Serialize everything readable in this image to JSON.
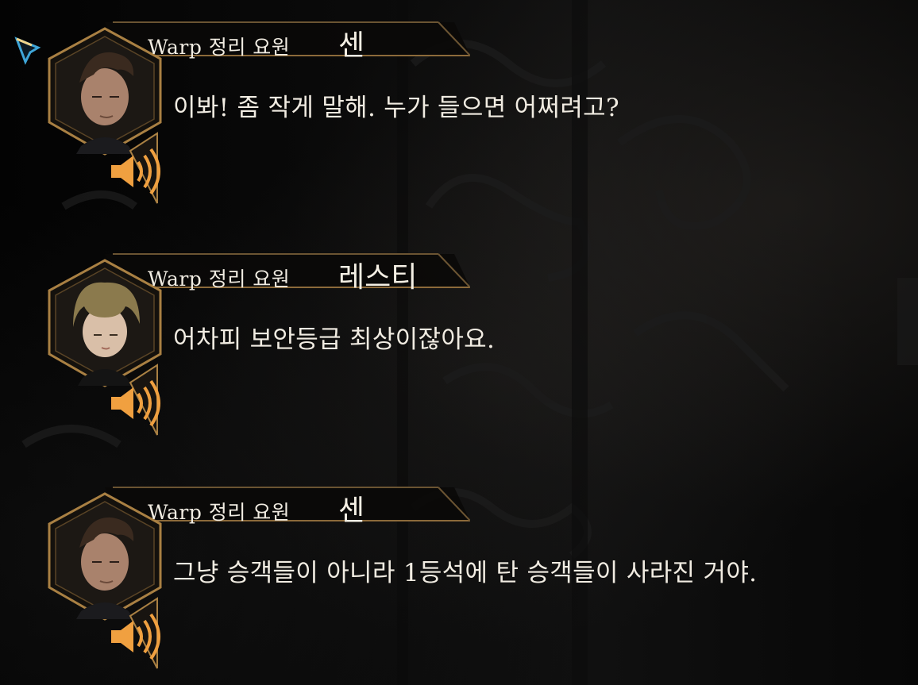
{
  "dialogue_log": [
    {
      "speaker_title": "Warp 정리 요원",
      "speaker_name": "센",
      "portrait": "sen-portrait",
      "text": "이봐! 좀 작게 말해. 누가 들으면 어쩌려고?",
      "voice_icon": "speaker-icon"
    },
    {
      "speaker_title": "Warp 정리 요원",
      "speaker_name": "레스티",
      "portrait": "resti-portrait",
      "text": "어차피 보안등급 최상이잖아요.",
      "voice_icon": "speaker-icon"
    },
    {
      "speaker_title": "Warp 정리 요원",
      "speaker_name": "센",
      "portrait": "sen-portrait",
      "text": "그냥 승객들이 아니라 1등석에 탄 승객들이 사라진 거야.",
      "voice_icon": "speaker-icon"
    }
  ],
  "colors": {
    "frame_gold": "#b58a4a",
    "voice_orange": "#f0a040",
    "text": "#f1ece2",
    "background": "#050505"
  }
}
